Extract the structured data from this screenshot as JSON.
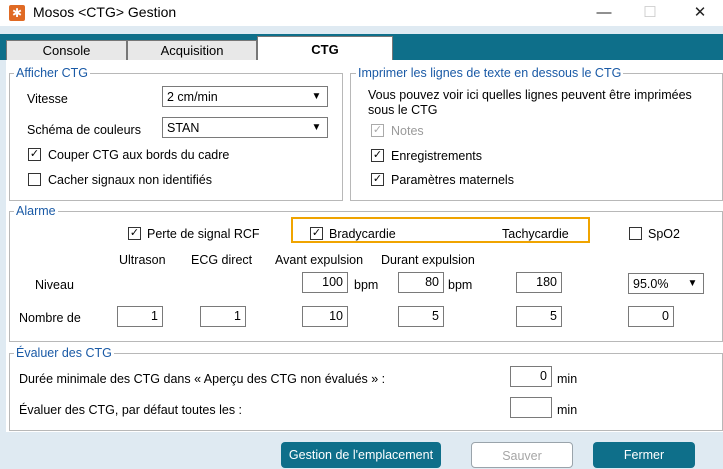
{
  "window": {
    "title": "Mosos <CTG> Gestion",
    "icon": "gear-icon",
    "minimize": "—",
    "maximize": "☐",
    "close": "✕"
  },
  "tabs": [
    {
      "label": "Console",
      "active": false
    },
    {
      "label": "Acquisition",
      "active": false
    },
    {
      "label": "CTG",
      "active": true
    }
  ],
  "afficher": {
    "legend": "Afficher CTG",
    "vitesse_label": "Vitesse",
    "vitesse_value": "2 cm/min",
    "schema_label": "Schéma de couleurs",
    "schema_value": "STAN",
    "couper_label": "Couper CTG aux bords du cadre",
    "couper_checked": true,
    "cacher_label": "Cacher signaux non identifiés",
    "cacher_checked": false
  },
  "imprimer": {
    "legend": "Imprimer les lignes de texte en dessous le CTG",
    "desc_line1": "Vous pouvez voir ici quelles lignes peuvent être imprimées",
    "desc_line2": "sous le CTG",
    "notes_label": "Notes",
    "notes_checked": true,
    "notes_disabled": true,
    "enregistrements_label": "Enregistrements",
    "enregistrements_checked": true,
    "parametres_label": "Paramètres maternels",
    "parametres_checked": true
  },
  "alarme": {
    "legend": "Alarme",
    "perte_label": "Perte de signal RCF",
    "perte_checked": true,
    "brady_label": "Bradycardie",
    "brady_checked": true,
    "tachy_label": "Tachycardie",
    "spo2_label": "SpO2",
    "spo2_checked": false,
    "col_ultrason": "Ultrason",
    "col_ecg": "ECG direct",
    "col_avant": "Avant expulsion",
    "col_durant": "Durant expulsion",
    "niveau_label": "Niveau",
    "nombre_label": "Nombre de",
    "niveau_brady_avant": "100",
    "niveau_brady_durant": "80",
    "niveau_tachy": "180",
    "unit_bpm": "bpm",
    "niveau_spo2": "95.0%",
    "nombre_ultrason": "1",
    "nombre_ecg": "1",
    "nombre_brady_avant": "10",
    "nombre_brady_durant": "5",
    "nombre_tachy": "5",
    "nombre_spo2": "0"
  },
  "evaluer": {
    "legend": "Évaluer des CTG",
    "duree_label": "Durée minimale des CTG dans « Aperçu des CTG non évalués » :",
    "duree_value": "0",
    "duree_unit": "min",
    "defaut_label": "Évaluer des CTG, par défaut toutes les :",
    "defaut_value": "",
    "defaut_unit": "min"
  },
  "footer": {
    "gestion_label": "Gestion de l'emplacement",
    "sauver_label": "Sauver",
    "fermer_label": "Fermer"
  },
  "colors": {
    "accent": "#0e6f8a",
    "legend_text": "#1a5aa6",
    "highlight": "#f0a400",
    "background": "#dfeaf2"
  }
}
